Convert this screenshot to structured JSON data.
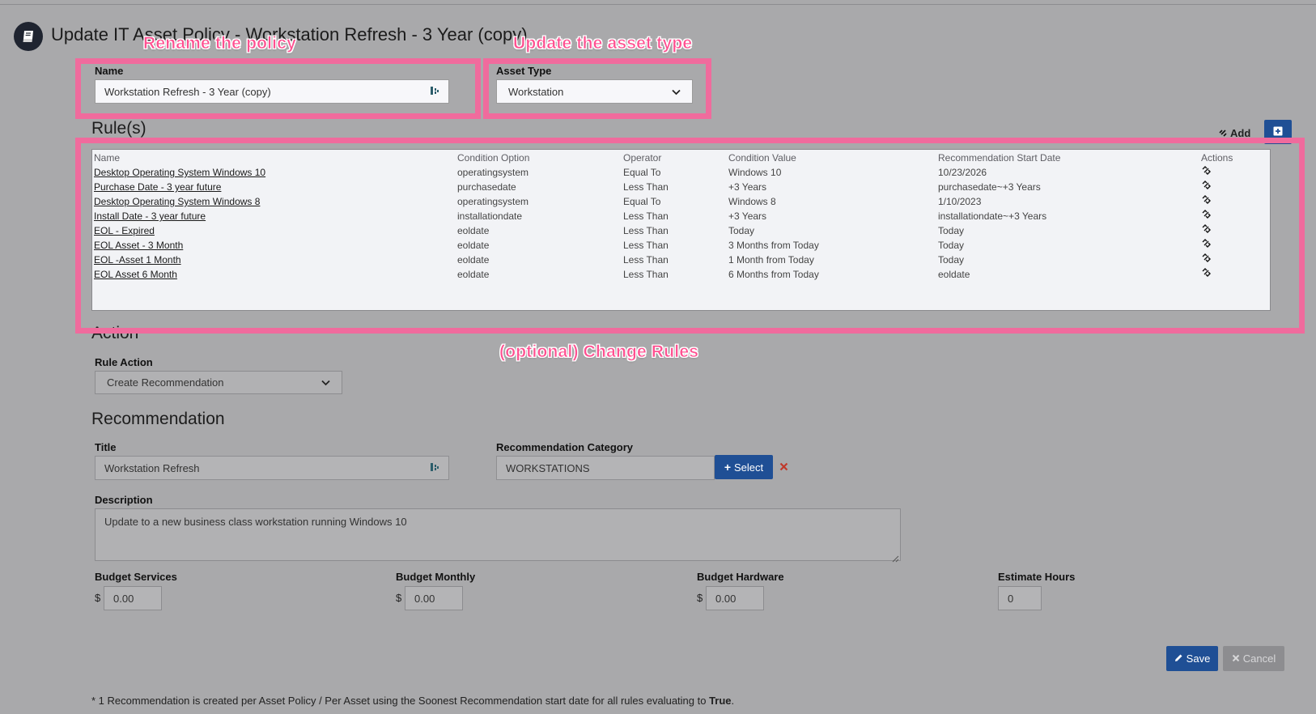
{
  "page": {
    "title": "Update IT Asset Policy - Workstation Refresh - 3 Year (copy)"
  },
  "annotations": {
    "rename": "Rename the policy",
    "asset_type": "Update the asset type",
    "rules": "(optional) Change Rules"
  },
  "form": {
    "name_label": "Name",
    "name_value": "Workstation Refresh - 3 Year (copy)",
    "asset_type_label": "Asset Type",
    "asset_type_value": "Workstation"
  },
  "rules": {
    "section_title": "Rule(s)",
    "add_label": "Add",
    "columns": [
      "Name",
      "Condition Option",
      "Operator",
      "Condition Value",
      "Recommendation Start Date",
      "Actions"
    ],
    "rows": [
      {
        "name": "Desktop Operating System Windows 10",
        "condition_option": "operatingsystem",
        "operator": "Equal To",
        "condition_value": "Windows 10",
        "start_date": "10/23/2026"
      },
      {
        "name": "Purchase Date - 3 year future",
        "condition_option": "purchasedate",
        "operator": "Less Than",
        "condition_value": "+3 Years",
        "start_date": "purchasedate~+3 Years"
      },
      {
        "name": "Desktop Operating System Windows 8",
        "condition_option": "operatingsystem",
        "operator": "Equal To",
        "condition_value": "Windows 8",
        "start_date": "1/10/2023"
      },
      {
        "name": "Install Date - 3 year future",
        "condition_option": "installationdate",
        "operator": "Less Than",
        "condition_value": "+3 Years",
        "start_date": "installationdate~+3 Years"
      },
      {
        "name": "EOL - Expired",
        "condition_option": "eoldate",
        "operator": "Less Than",
        "condition_value": "Today",
        "start_date": "Today"
      },
      {
        "name": "EOL Asset - 3 Month",
        "condition_option": "eoldate",
        "operator": "Less Than",
        "condition_value": "3 Months from Today",
        "start_date": "Today"
      },
      {
        "name": "EOL -Asset 1 Month",
        "condition_option": "eoldate",
        "operator": "Less Than",
        "condition_value": "1 Month from Today",
        "start_date": "Today"
      },
      {
        "name": "EOL Asset 6 Month",
        "condition_option": "eoldate",
        "operator": "Less Than",
        "condition_value": "6 Months from Today",
        "start_date": "eoldate"
      }
    ]
  },
  "action": {
    "section_title": "Action",
    "rule_action_label": "Rule Action",
    "rule_action_value": "Create Recommendation"
  },
  "recommendation": {
    "section_title": "Recommendation",
    "title_label": "Title",
    "title_value": "Workstation Refresh",
    "category_label": "Recommendation Category",
    "category_value": "WORKSTATIONS",
    "select_label": "Select",
    "description_label": "Description",
    "description_value": "Update to a new business class workstation running Windows 10",
    "budget_services_label": "Budget Services",
    "budget_services_value": "0.00",
    "budget_monthly_label": "Budget Monthly",
    "budget_monthly_value": "0.00",
    "budget_hardware_label": "Budget Hardware",
    "budget_hardware_value": "0.00",
    "estimate_hours_label": "Estimate Hours",
    "estimate_hours_value": "0",
    "currency_symbol": "$"
  },
  "buttons": {
    "save": "Save",
    "cancel": "Cancel"
  },
  "footer": {
    "note_prefix": "* 1 Recommendation is created per Asset Policy / Per Asset using the Soonest Recommendation start date for all rules evaluating to ",
    "note_bold": "True",
    "note_suffix": "."
  },
  "colors": {
    "highlight": "#f06b9d",
    "primary_button": "#1f4f95",
    "remove_x": "#c0392b"
  }
}
